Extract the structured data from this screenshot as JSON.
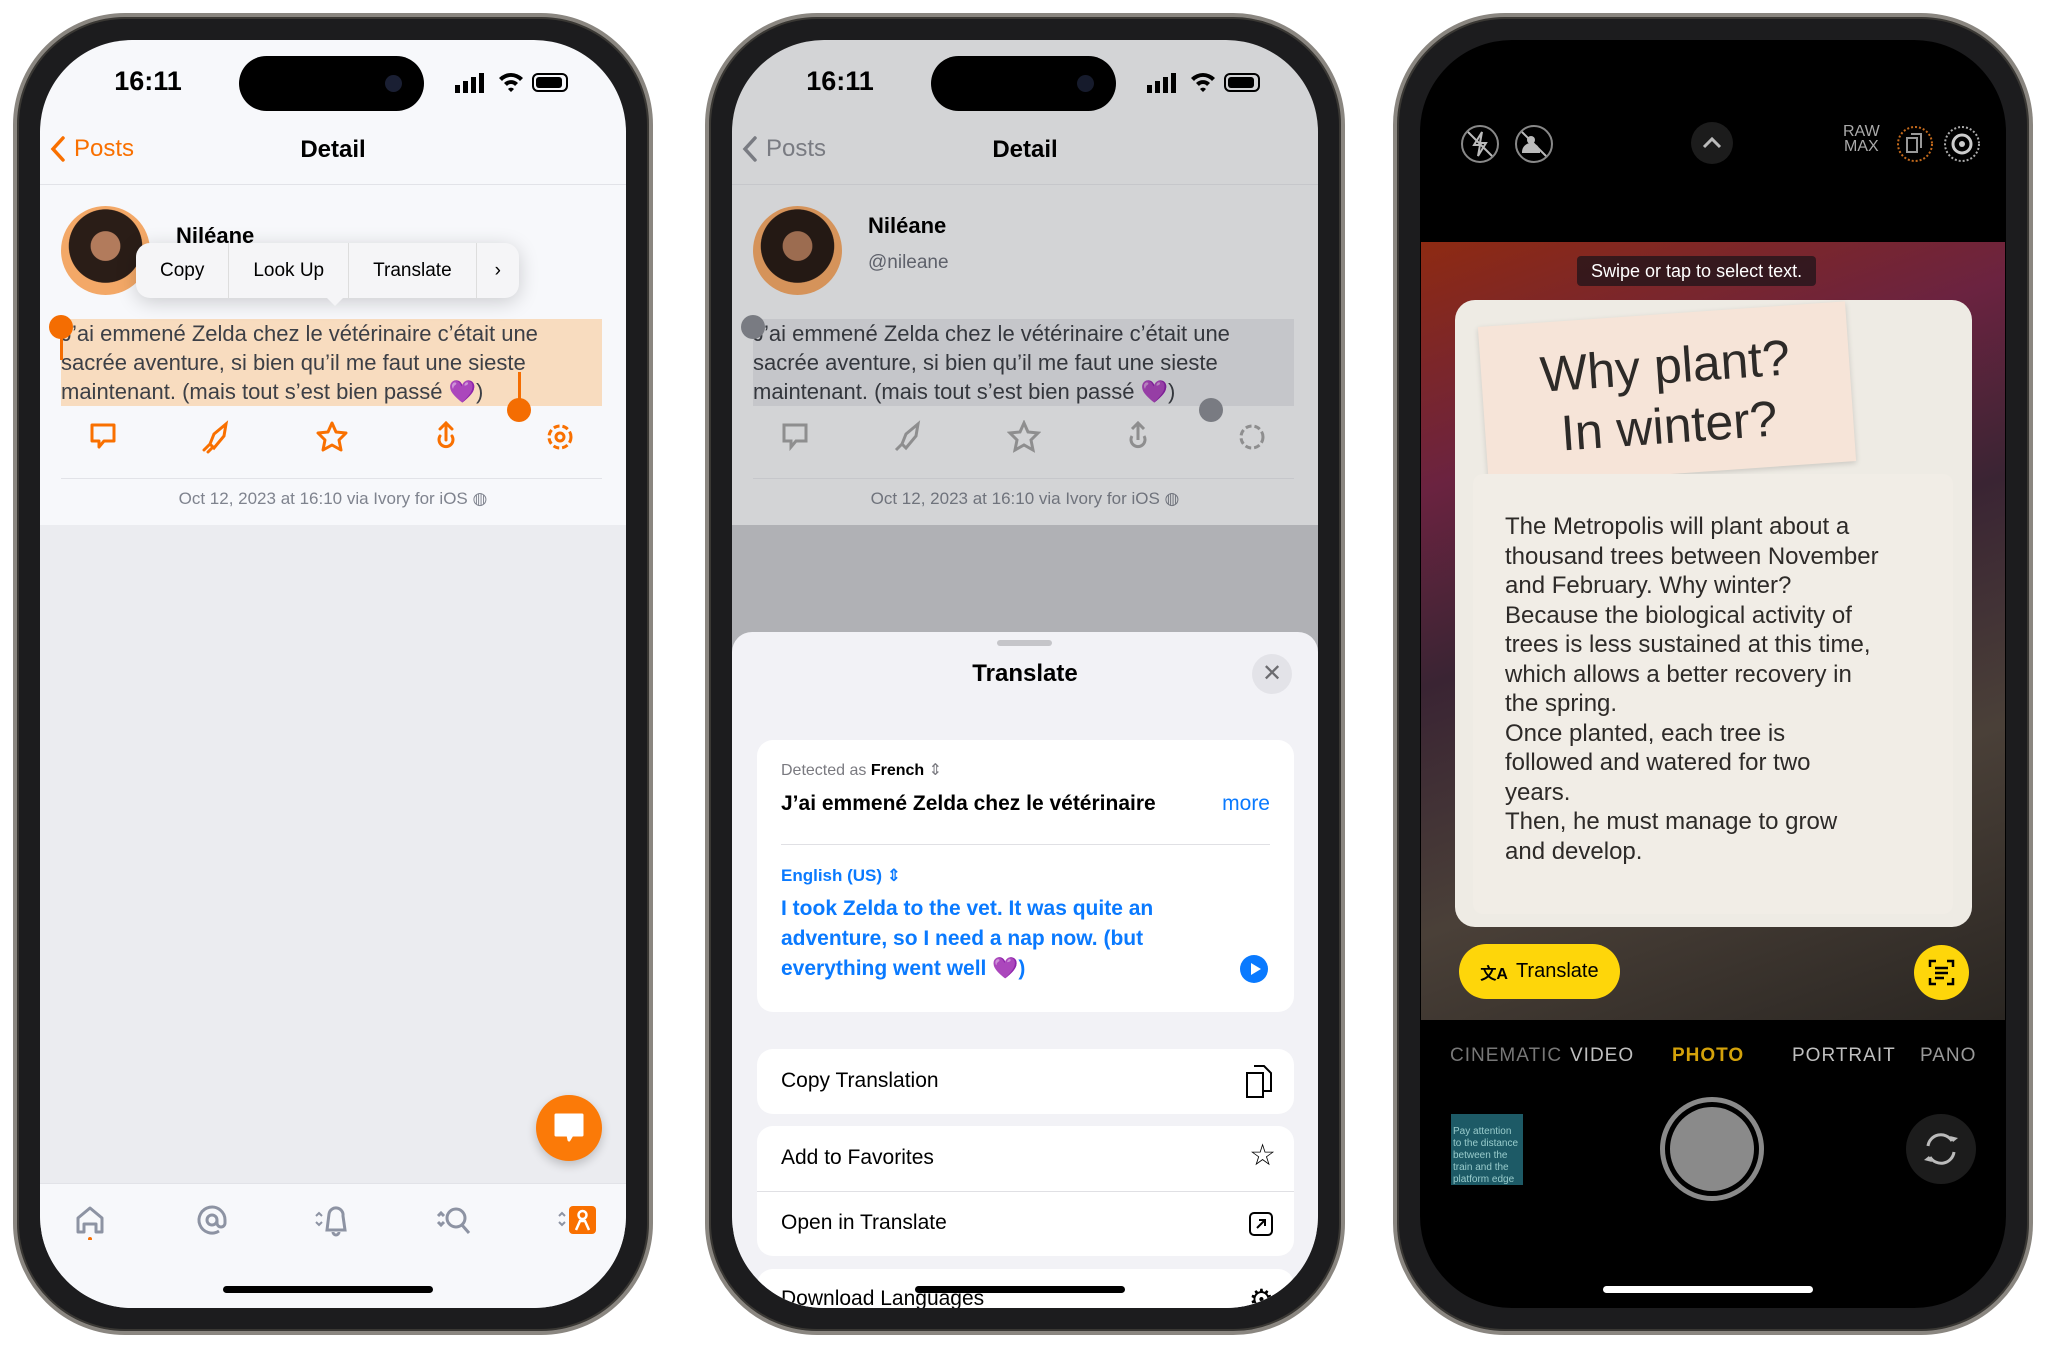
{
  "status": {
    "time": "16:11"
  },
  "phone1": {
    "nav": {
      "back": "Posts",
      "title": "Detail"
    },
    "post": {
      "name": "Niléane",
      "handle": "@nileane",
      "text": "J’ai emmené Zelda chez le vétérinaire c’était une sacrée aventure, si bien qu’il me faut une sieste maintenant. (mais tout s’est bien passé 💜)",
      "timestamp": "Oct 12, 2023 at 16:10 via Ivory for iOS"
    },
    "menu": [
      "Copy",
      "Look Up",
      "Translate",
      "›"
    ],
    "accent": "#F97000"
  },
  "phone2": {
    "sheet": {
      "title": "Translate",
      "detected_prefix": "Detected as",
      "detected_lang": "French",
      "source_text": "J’ai emmené Zelda chez le vétérinaire",
      "more": "more",
      "target_lang": "English (US)",
      "translation": "I took Zelda to the vet. It was quite an adventure, so I need a nap now. (but everything went well 💜)",
      "actions": [
        "Copy Translation",
        "Add to Favorites",
        "Open in Translate",
        "Download Languages"
      ]
    },
    "link_color": "#0A7AFF"
  },
  "phone3": {
    "top": {
      "raw_label": "RAW",
      "max_label": "MAX"
    },
    "hint": "Swipe or tap to select text.",
    "note": {
      "headline1": "Why plant?",
      "headline2": "In winter?",
      "body": [
        "The Metropolis will plant about a",
        "thousand trees between November",
        "and February. Why winter?",
        "Because the biological activity of",
        "trees is less sustained at this time,",
        "which allows a better recovery in",
        "the spring.",
        "Once planted, each tree is",
        "followed and watered for two",
        "years.",
        "Then, he must manage to grow",
        "and develop."
      ]
    },
    "translate_button": "Translate",
    "modes": [
      "CINEMATIC",
      "VIDEO",
      "PHOTO",
      "PORTRAIT",
      "PANO"
    ],
    "active_mode": "PHOTO",
    "thumbnail_text": "Pay attention to the distance between the train and the platform edge",
    "mode_color": "#D4A20A"
  }
}
